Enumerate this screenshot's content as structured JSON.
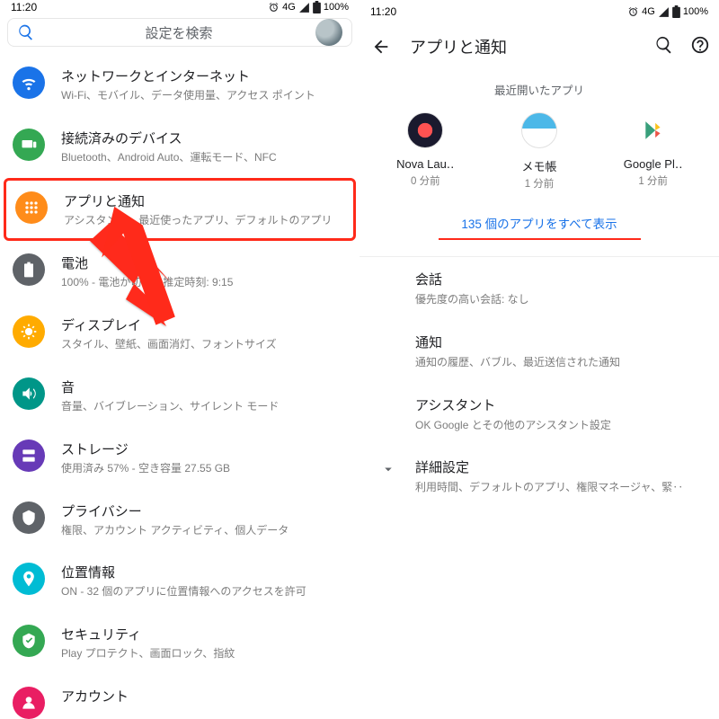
{
  "status": {
    "time": "11:20",
    "net": "4G",
    "battery": "100%"
  },
  "left": {
    "search_placeholder": "設定を検索",
    "items": [
      {
        "title": "ネットワークとインターネット",
        "sub": "Wi-Fi、モバイル、データ使用量、アクセス ポイント"
      },
      {
        "title": "接続済みのデバイス",
        "sub": "Bluetooth、Android Auto、運転モード、NFC"
      },
      {
        "title": "アプリと通知",
        "sub": "アシスタント、最近使ったアプリ、デフォルトのアプリ"
      },
      {
        "title": "電池",
        "sub": "100% - 電池が切れる推定時刻: 9:15"
      },
      {
        "title": "ディスプレイ",
        "sub": "スタイル、壁紙、画面消灯、フォントサイズ"
      },
      {
        "title": "音",
        "sub": "音量、バイブレーション、サイレント モード"
      },
      {
        "title": "ストレージ",
        "sub": "使用済み 57% - 空き容量 27.55 GB"
      },
      {
        "title": "プライバシー",
        "sub": "権限、アカウント アクティビティ、個人データ"
      },
      {
        "title": "位置情報",
        "sub": "ON - 32 個のアプリに位置情報へのアクセスを許可"
      },
      {
        "title": "セキュリティ",
        "sub": "Play プロテクト、画面ロック、指紋"
      },
      {
        "title": "アカウント",
        "sub": ""
      }
    ]
  },
  "right": {
    "title": "アプリと通知",
    "recent_label": "最近開いたアプリ",
    "recent": [
      {
        "name": "Nova Lau‥",
        "time": "0 分前"
      },
      {
        "name": "メモ帳",
        "time": "1 分前"
      },
      {
        "name": "Google Pl‥",
        "time": "1 分前"
      }
    ],
    "show_all": "135 個のアプリをすべて表示",
    "rows": [
      {
        "title": "会話",
        "sub": "優先度の高い会話: なし"
      },
      {
        "title": "通知",
        "sub": "通知の履歴、バブル、最近送信された通知"
      },
      {
        "title": "アシスタント",
        "sub": "OK Google とその他のアシスタント設定"
      }
    ],
    "advanced": {
      "title": "詳細設定",
      "sub": "利用時間、デフォルトのアプリ、権限マネージャ、緊‥"
    }
  }
}
